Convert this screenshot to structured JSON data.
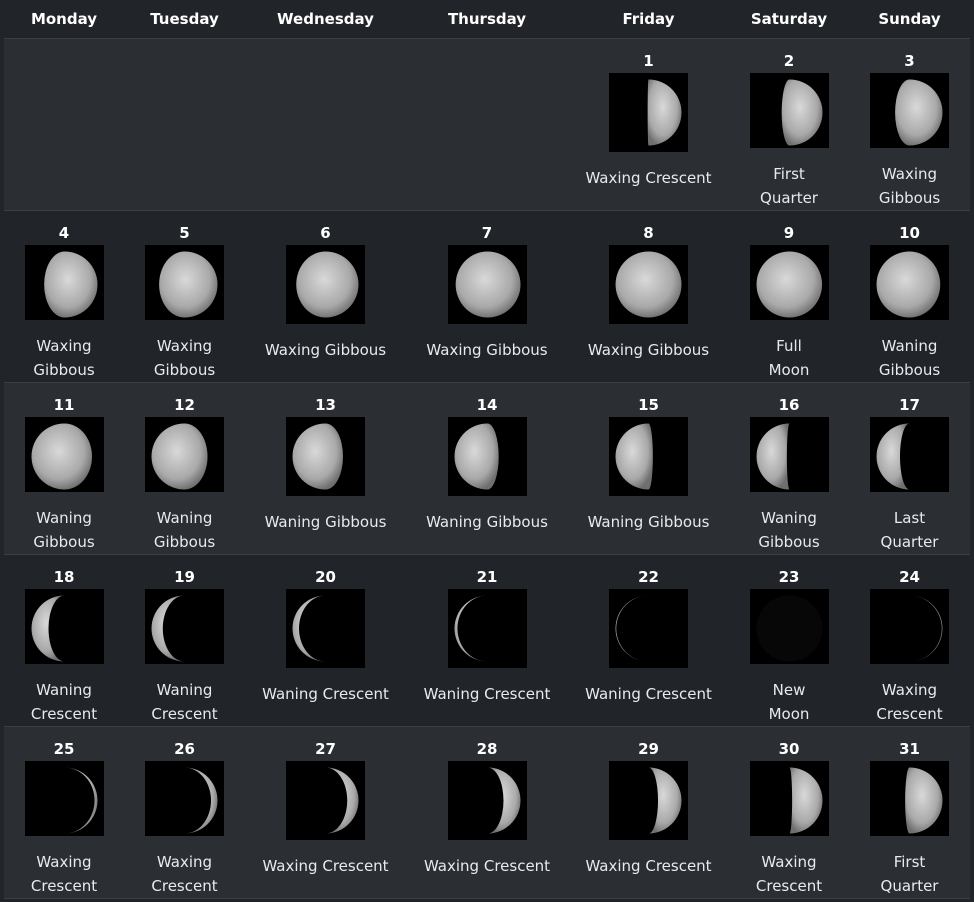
{
  "weekdays": [
    "Monday",
    "Tuesday",
    "Wednesday",
    "Thursday",
    "Friday",
    "Saturday",
    "Sunday"
  ],
  "weeks": [
    [
      null,
      null,
      null,
      null,
      {
        "day": "1",
        "phase": "Waxing Crescent"
      },
      {
        "day": "2",
        "phase": "First Quarter"
      },
      {
        "day": "3",
        "phase": "Waxing Gibbous"
      }
    ],
    [
      {
        "day": "4",
        "phase": "Waxing Gibbous"
      },
      {
        "day": "5",
        "phase": "Waxing Gibbous"
      },
      {
        "day": "6",
        "phase": "Waxing Gibbous"
      },
      {
        "day": "7",
        "phase": "Waxing Gibbous"
      },
      {
        "day": "8",
        "phase": "Waxing Gibbous"
      },
      {
        "day": "9",
        "phase": "Full Moon"
      },
      {
        "day": "10",
        "phase": "Waning Gibbous"
      }
    ],
    [
      {
        "day": "11",
        "phase": "Waning Gibbous"
      },
      {
        "day": "12",
        "phase": "Waning Gibbous"
      },
      {
        "day": "13",
        "phase": "Waning Gibbous"
      },
      {
        "day": "14",
        "phase": "Waning Gibbous"
      },
      {
        "day": "15",
        "phase": "Waning Gibbous"
      },
      {
        "day": "16",
        "phase": "Waning Gibbous"
      },
      {
        "day": "17",
        "phase": "Last Quarter"
      }
    ],
    [
      {
        "day": "18",
        "phase": "Waning Crescent"
      },
      {
        "day": "19",
        "phase": "Waning Crescent"
      },
      {
        "day": "20",
        "phase": "Waning Crescent"
      },
      {
        "day": "21",
        "phase": "Waning Crescent"
      },
      {
        "day": "22",
        "phase": "Waning Crescent"
      },
      {
        "day": "23",
        "phase": "New Moon"
      },
      {
        "day": "24",
        "phase": "Waxing Crescent"
      }
    ],
    [
      {
        "day": "25",
        "phase": "Waxing Crescent"
      },
      {
        "day": "26",
        "phase": "Waxing Crescent"
      },
      {
        "day": "27",
        "phase": "Waxing Crescent"
      },
      {
        "day": "28",
        "phase": "Waxing Crescent"
      },
      {
        "day": "29",
        "phase": "Waxing Crescent"
      },
      {
        "day": "30",
        "phase": "Waxing Crescent"
      },
      {
        "day": "31",
        "phase": "First Quarter"
      }
    ]
  ],
  "colors": {
    "background": "#212429",
    "row_alt": "#2b2e33",
    "border": "#3a3e45",
    "text": "#e8eaed"
  }
}
